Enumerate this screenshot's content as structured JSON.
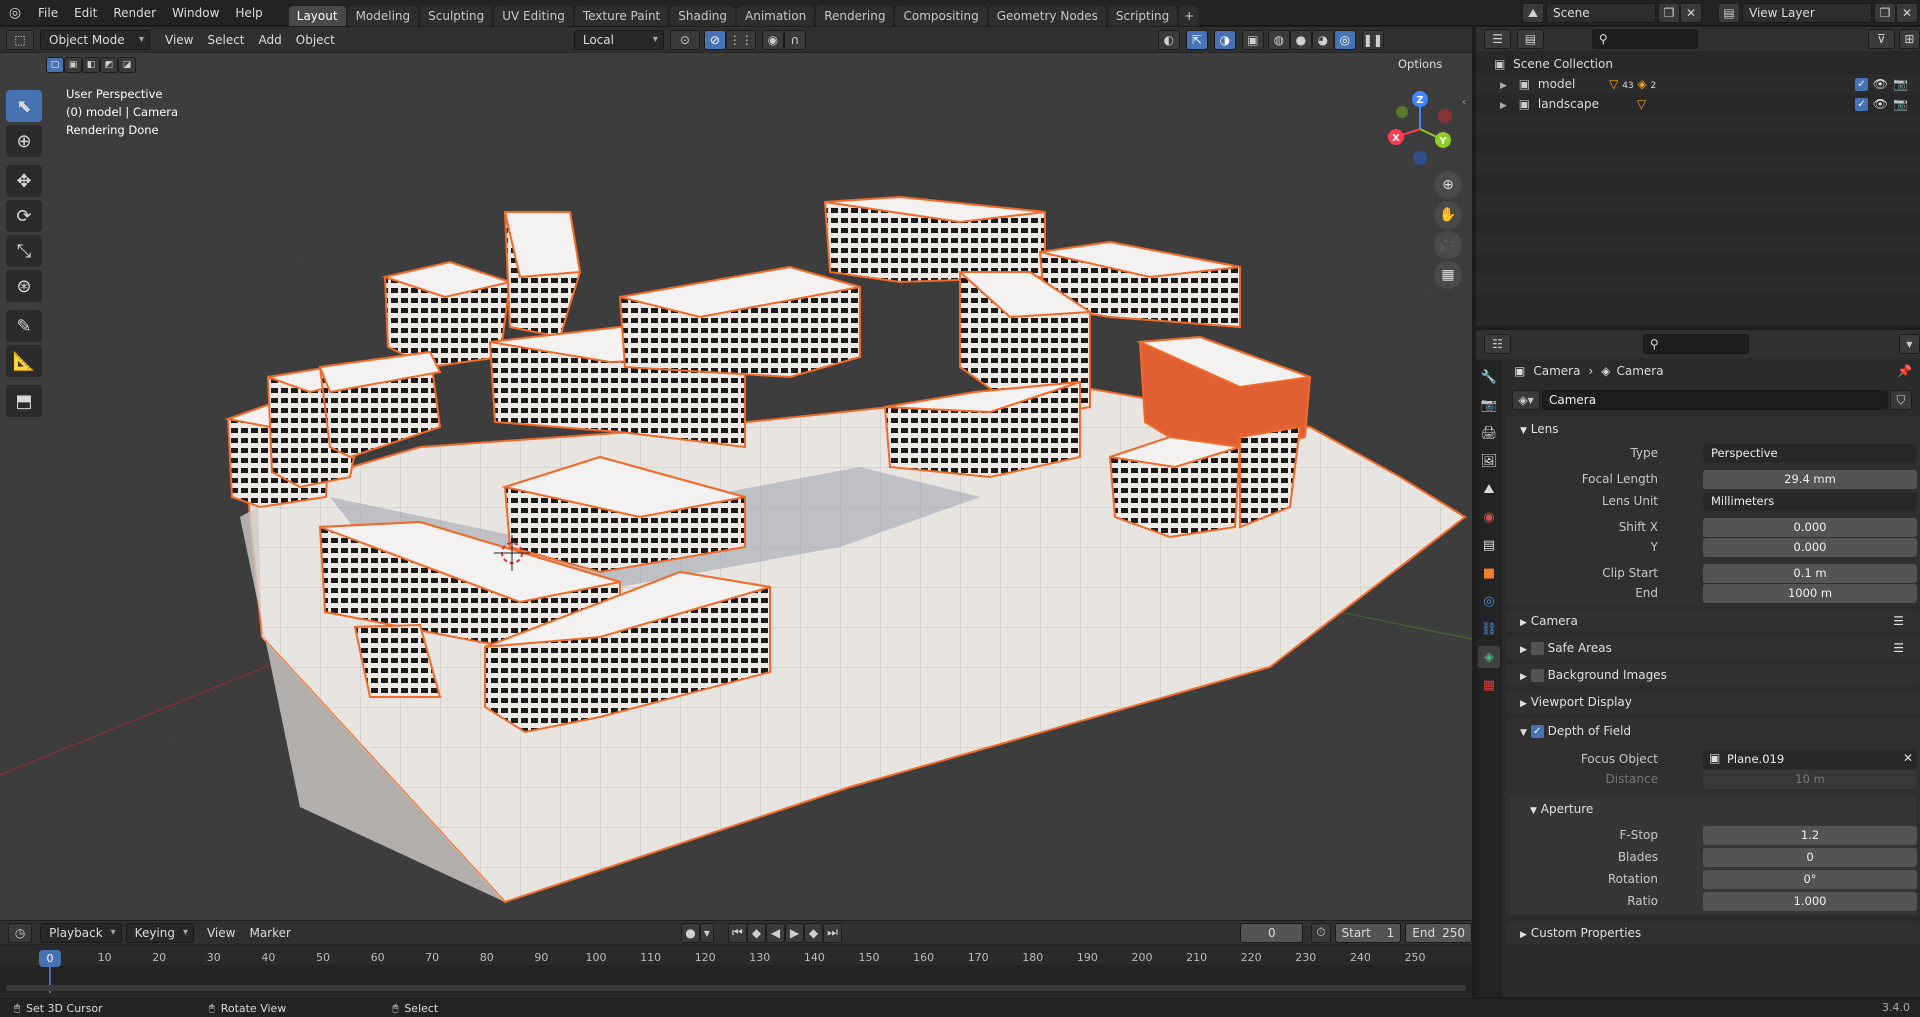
{
  "app": {
    "version": "3.4.0"
  },
  "topbar": {
    "menus": [
      "File",
      "Edit",
      "Render",
      "Window",
      "Help"
    ],
    "tabs": [
      "Layout",
      "Modeling",
      "Sculpting",
      "UV Editing",
      "Texture Paint",
      "Shading",
      "Animation",
      "Rendering",
      "Compositing",
      "Geometry Nodes",
      "Scripting"
    ],
    "active_tab": "Layout",
    "add_tab": "+",
    "scene": "Scene",
    "view_layer": "View Layer"
  },
  "viewport": {
    "mode": "Object Mode",
    "menus": [
      "View",
      "Select",
      "Add",
      "Object"
    ],
    "orientation": "Local",
    "options_label": "Options",
    "overlay_lines": [
      "User Perspective",
      "(0) model | Camera",
      "Rendering Done"
    ],
    "gizmo_axes": {
      "x": "X",
      "y": "Y",
      "z": "Z"
    }
  },
  "timeline": {
    "playback": "Playback",
    "keying": "Keying",
    "menus": [
      "View",
      "Marker"
    ],
    "current_frame": "0",
    "start_label": "Start",
    "start": "1",
    "end_label": "End",
    "end": "250",
    "ticks": [
      "0",
      "10",
      "20",
      "30",
      "40",
      "50",
      "60",
      "70",
      "80",
      "90",
      "100",
      "110",
      "120",
      "130",
      "140",
      "150",
      "160",
      "170",
      "180",
      "190",
      "200",
      "210",
      "220",
      "230",
      "240",
      "250"
    ],
    "playhead": "0"
  },
  "statusbar": {
    "items": [
      "Set 3D Cursor",
      "Rotate View",
      "Select"
    ]
  },
  "outliner": {
    "root": "Scene Collection",
    "collections": [
      {
        "name": "model",
        "badge_a": "43",
        "badge_b": "2"
      },
      {
        "name": "landscape"
      }
    ]
  },
  "properties": {
    "breadcrumb": [
      "Camera",
      "Camera"
    ],
    "datablock": "Camera",
    "lens_panel": "Lens",
    "type_label": "Type",
    "type_value": "Perspective",
    "focal_label": "Focal Length",
    "focal_value": "29.4 mm",
    "lens_unit_label": "Lens Unit",
    "lens_unit_value": "Millimeters",
    "shift_x_label": "Shift X",
    "shift_x_value": "0.000",
    "shift_y_label": "Y",
    "shift_y_value": "0.000",
    "clip_start_label": "Clip Start",
    "clip_start_value": "0.1 m",
    "clip_end_label": "End",
    "clip_end_value": "1000 m",
    "camera_panel": "Camera",
    "safe_areas_panel": "Safe Areas",
    "bg_images_panel": "Background Images",
    "viewport_display_panel": "Viewport Display",
    "dof_panel": "Depth of Field",
    "focus_object_label": "Focus Object",
    "focus_object_value": "Plane.019",
    "distance_label": "Distance",
    "distance_value": "10 m",
    "aperture_panel": "Aperture",
    "fstop_label": "F-Stop",
    "fstop_value": "1.2",
    "blades_label": "Blades",
    "blades_value": "0",
    "rotation_label": "Rotation",
    "rotation_value": "0°",
    "ratio_label": "Ratio",
    "ratio_value": "1.000",
    "custom_props_panel": "Custom Properties"
  },
  "colors": {
    "accent": "#4772b3",
    "selection_outline": "#f06a2a",
    "building": "#ece8e4",
    "ground": "#e8e4e0"
  }
}
